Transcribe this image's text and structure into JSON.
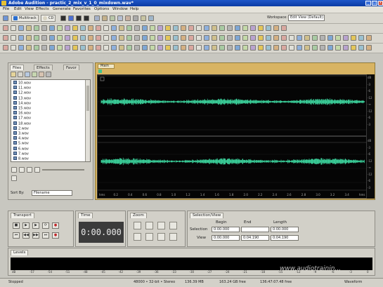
{
  "window": {
    "title": "Adobe Audition - practic_2_mix_v_1_0_mixdown.wav*",
    "minimize": "_",
    "maximize": "□",
    "close": "x"
  },
  "menu": [
    "File",
    "Edit",
    "View",
    "Effects",
    "Generate",
    "Favorites",
    "Options",
    "Window",
    "Help"
  ],
  "toolbar": {
    "multitrack_label": "Multitrack",
    "cd_label": "CD",
    "workspace_label": "Workspace:",
    "workspace_value": "Edit View (Default)"
  },
  "left_panel": {
    "tabs": [
      "Files",
      "Effects",
      "Favor"
    ],
    "files": [
      "10.wav",
      "11.wav",
      "12.wav",
      "13.wav",
      "14.wav",
      "15.wav",
      "16.wav",
      "17.wav",
      "18.wav",
      "2.wav",
      "3.wav",
      "4.wav",
      "5.wav",
      "6.wav",
      "7.wav",
      "8.wav"
    ],
    "sort_label": "Sort By:",
    "sort_value": "Filename"
  },
  "main_panel": {
    "tab": "Main",
    "time_ruler": [
      "hms",
      "0.2",
      "0.4",
      "0.6",
      "0.8",
      "1.0",
      "1.2",
      "1.4",
      "1.6",
      "1.8",
      "2.0",
      "2.2",
      "2.4",
      "2.6",
      "2.8",
      "3.0",
      "3.2",
      "3.4",
      "hms"
    ],
    "db_ruler_top": [
      "dB",
      "-3",
      "-6",
      "-12",
      "-∞",
      "-12",
      "-6",
      "-3"
    ],
    "db_ruler_bottom": [
      "dB",
      "-3",
      "-6",
      "-12",
      "-∞",
      "-12",
      "-6",
      "-3"
    ]
  },
  "transport": {
    "tab": "Transport",
    "buttons": [
      "■",
      "▶",
      "▶",
      "⟳",
      "●",
      "⏮",
      "◀◀",
      "▶▶",
      "⏭",
      "●"
    ]
  },
  "time": {
    "tab": "Time",
    "display": "0:00.000"
  },
  "zoom": {
    "tab": "Zoom"
  },
  "selection_view": {
    "tab": "Selection/View",
    "col_begin": "Begin",
    "col_end": "End",
    "col_length": "Length",
    "row_selection": "Selection",
    "row_view": "View",
    "selection_begin": "0:00.000",
    "selection_end": "",
    "selection_length": "0:00.000",
    "view_begin": "0:00.000",
    "view_end": "0:04.190",
    "view_length": "0:04.190"
  },
  "levels": {
    "tab": "Levels",
    "scale": [
      "dB",
      "-57",
      "-54",
      "-51",
      "-48",
      "-45",
      "-42",
      "-39",
      "-36",
      "-33",
      "-30",
      "-27",
      "-24",
      "-21",
      "-18",
      "-15",
      "-12",
      "-9",
      "-6",
      "-3",
      "0"
    ]
  },
  "status": {
    "state": "Stopped",
    "format": "48000 • 32-bit • Stereo",
    "size": "136.39 MB",
    "free1": "163.24 GB free",
    "free2": "136:47:07.48 free",
    "mode": "Waveform"
  },
  "watermark": "www.audiotrainin..."
}
